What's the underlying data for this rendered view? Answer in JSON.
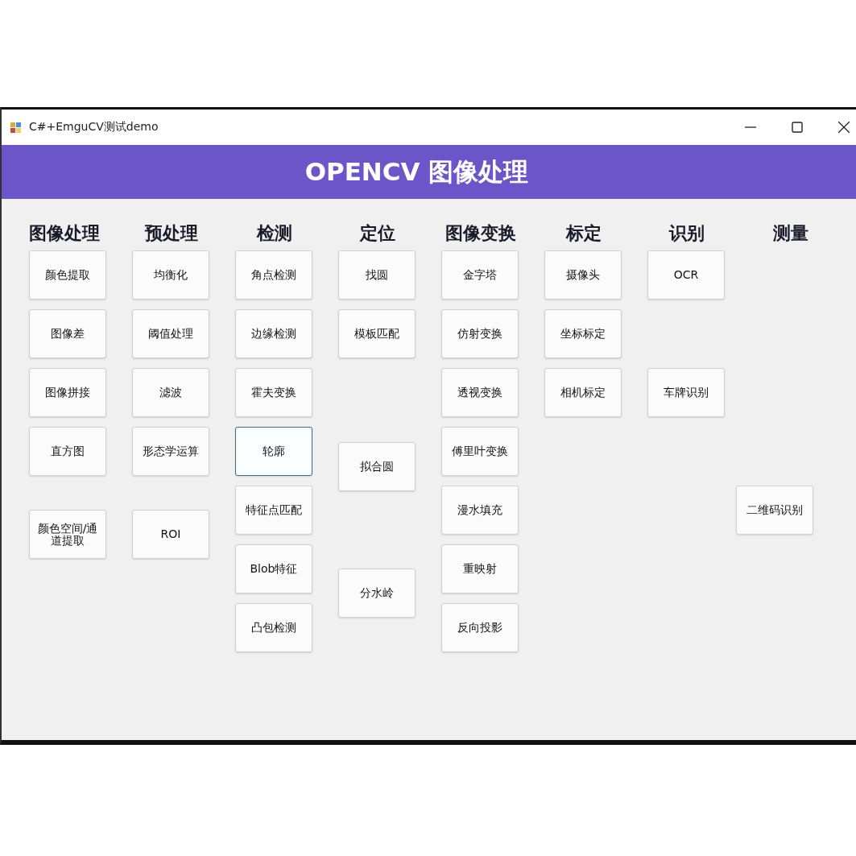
{
  "window": {
    "title": "C#+EmguCV测试demo"
  },
  "banner": {
    "title": "OPENCV 图像处理"
  },
  "columns": [
    {
      "heading": "图像处理",
      "buttons": [
        {
          "label": "颜色提取",
          "focused": false
        },
        {
          "label": "图像差",
          "focused": false
        },
        {
          "label": "图像拼接",
          "focused": false
        },
        {
          "label": "直方图",
          "focused": false
        },
        {
          "label": "颜色空间/通道提取",
          "focused": false
        }
      ]
    },
    {
      "heading": "预处理",
      "buttons": [
        {
          "label": "均衡化",
          "focused": false
        },
        {
          "label": "阈值处理",
          "focused": false
        },
        {
          "label": "滤波",
          "focused": false
        },
        {
          "label": "形态学运算",
          "focused": false
        },
        {
          "label": "ROI",
          "focused": false
        }
      ]
    },
    {
      "heading": "检测",
      "buttons": [
        {
          "label": "角点检测",
          "focused": false
        },
        {
          "label": "边缘检测",
          "focused": false
        },
        {
          "label": "霍夫变换",
          "focused": false
        },
        {
          "label": "轮廓",
          "focused": true
        },
        {
          "label": "特征点匹配",
          "focused": false
        },
        {
          "label": "Blob特征",
          "focused": false
        },
        {
          "label": "凸包检测",
          "focused": false
        }
      ]
    },
    {
      "heading": "定位",
      "buttons": [
        {
          "label": "找圆",
          "focused": false
        },
        {
          "label": "模板匹配",
          "focused": false
        },
        {
          "label": "拟合圆",
          "focused": false
        },
        {
          "label": "分水岭",
          "focused": false
        }
      ]
    },
    {
      "heading": "图像变换",
      "buttons": [
        {
          "label": "金字塔",
          "focused": false
        },
        {
          "label": "仿射变换",
          "focused": false
        },
        {
          "label": "透视变换",
          "focused": false
        },
        {
          "label": "傅里叶变换",
          "focused": false
        },
        {
          "label": "漫水填充",
          "focused": false
        },
        {
          "label": "重映射",
          "focused": false
        },
        {
          "label": "反向投影",
          "focused": false
        }
      ]
    },
    {
      "heading": "标定",
      "buttons": [
        {
          "label": "摄像头",
          "focused": false
        },
        {
          "label": "坐标标定",
          "focused": false
        },
        {
          "label": "相机标定",
          "focused": false
        }
      ]
    },
    {
      "heading": "识别",
      "buttons": [
        {
          "label": "OCR",
          "focused": false
        },
        {
          "label": "车牌识别",
          "focused": false
        }
      ]
    },
    {
      "heading": "测量",
      "buttons": [
        {
          "label": "二维码识别",
          "focused": false
        }
      ]
    }
  ]
}
